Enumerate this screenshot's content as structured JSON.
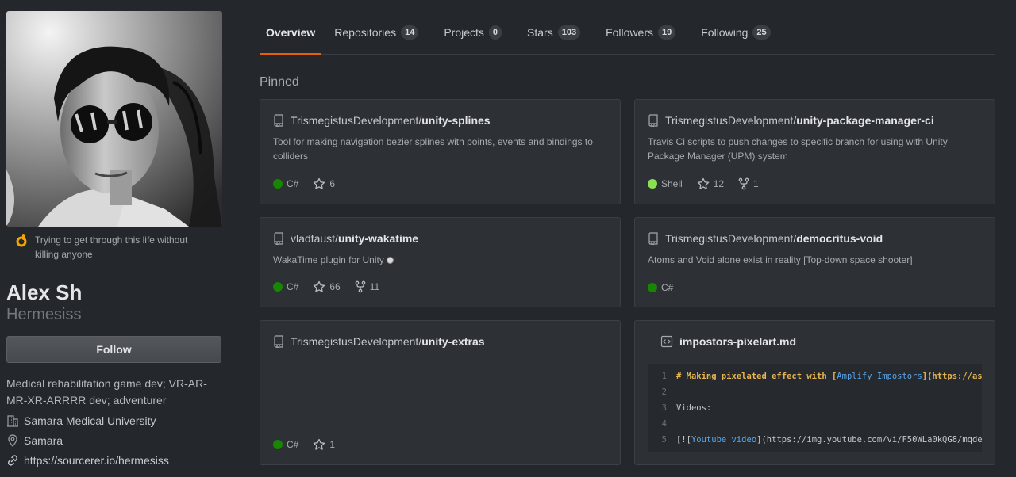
{
  "profile": {
    "status": "Trying to get through this life without killing anyone",
    "name": "Alex Sh",
    "login": "Hermesiss",
    "follow_label": "Follow",
    "bio": "Medical rehabilitation game dev; VR-AR-MR-XR-ARRRR dev; adventurer",
    "company": "Samara Medical University",
    "location": "Samara",
    "website": "https://sourcerer.io/hermesiss"
  },
  "tabs": [
    {
      "label": "Overview",
      "count": null,
      "selected": true
    },
    {
      "label": "Repositories",
      "count": "14"
    },
    {
      "label": "Projects",
      "count": "0"
    },
    {
      "label": "Stars",
      "count": "103"
    },
    {
      "label": "Followers",
      "count": "19"
    },
    {
      "label": "Following",
      "count": "25"
    }
  ],
  "pinned_title": "Pinned",
  "pinned": [
    {
      "owner": "TrismegistusDevelopment/",
      "repo": "unity-splines",
      "description": "Tool for making navigation bezier splines with points, events and bindings to colliders",
      "language": "C#",
      "lang_color": "#178600",
      "stars": "6",
      "forks": null
    },
    {
      "owner": "TrismegistusDevelopment/",
      "repo": "unity-package-manager-ci",
      "description": "Travis Ci scripts to push changes to specific branch for using with Unity Package Manager (UPM) system",
      "language": "Shell",
      "lang_color": "#89e051",
      "stars": "12",
      "forks": "1"
    },
    {
      "owner": "vladfaust/",
      "repo": "unity-wakatime",
      "description": "WakaTime plugin for Unity",
      "language": "C#",
      "lang_color": "#178600",
      "stars": "66",
      "forks": "11"
    },
    {
      "owner": "TrismegistusDevelopment/",
      "repo": "democritus-void",
      "description": "Atoms and Void alone exist in reality [Top-down space shooter]",
      "language": "C#",
      "lang_color": "#178600",
      "stars": null,
      "forks": null
    },
    {
      "owner": "TrismegistusDevelopment/",
      "repo": "unity-extras",
      "description": "",
      "language": "C#",
      "lang_color": "#178600",
      "stars": "1",
      "forks": null
    }
  ],
  "gist": {
    "filename": "impostors-pixelart.md",
    "lines": [
      {
        "n": "1",
        "parts": [
          {
            "t": "# Making pixelated effect with [",
            "c": "h"
          },
          {
            "t": "Amplify Impostors",
            "c": "lk"
          },
          {
            "t": "](https://as",
            "c": "h"
          }
        ]
      },
      {
        "n": "2",
        "parts": []
      },
      {
        "n": "3",
        "parts": [
          {
            "t": "Videos:",
            "c": "ct"
          }
        ]
      },
      {
        "n": "4",
        "parts": []
      },
      {
        "n": "5",
        "parts": [
          {
            "t": "[![",
            "c": "ct"
          },
          {
            "t": "Youtube video",
            "c": "lk"
          },
          {
            "t": "](https://img.youtube.com/vi/F50WLa0kQG8/mqde",
            "c": "ct"
          }
        ]
      }
    ]
  }
}
